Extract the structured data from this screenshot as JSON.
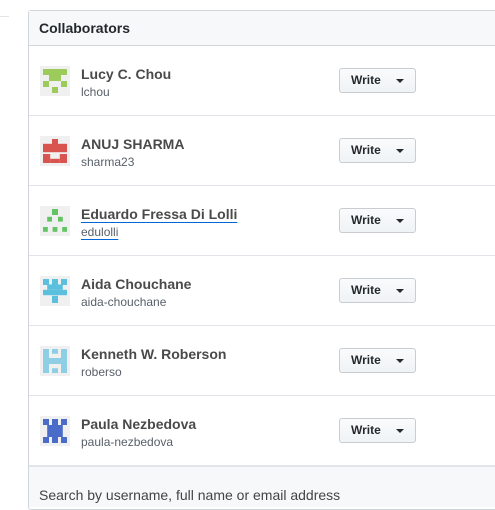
{
  "panel": {
    "title": "Collaborators"
  },
  "collaborators": [
    {
      "name": "Lucy C. Chou",
      "login": "lchou",
      "permission": "Write",
      "avatar_color": "#9ccb5c",
      "avatar_icon": "identicon-green"
    },
    {
      "name": "ANUJ SHARMA",
      "login": "sharma23",
      "permission": "Write",
      "avatar_color": "#d9534f",
      "avatar_icon": "identicon-red"
    },
    {
      "name": "Eduardo Fressa Di Lolli",
      "login": "edulolli",
      "permission": "Write",
      "avatar_color": "#62c462",
      "avatar_icon": "identicon-green-dots"
    },
    {
      "name": "Aida Chouchane",
      "login": "aida-chouchane",
      "permission": "Write",
      "avatar_color": "#5bc0de",
      "avatar_icon": "identicon-blue"
    },
    {
      "name": "Kenneth W. Roberson",
      "login": "roberso",
      "permission": "Write",
      "avatar_color": "#8fcfe6",
      "avatar_icon": "identicon-light-blue"
    },
    {
      "name": "Paula Nezbedova",
      "login": "paula-nezbedova",
      "permission": "Write",
      "avatar_color": "#4a6cc8",
      "avatar_icon": "identicon-navy"
    }
  ],
  "search": {
    "placeholder": "Search by username, full name or email address"
  }
}
